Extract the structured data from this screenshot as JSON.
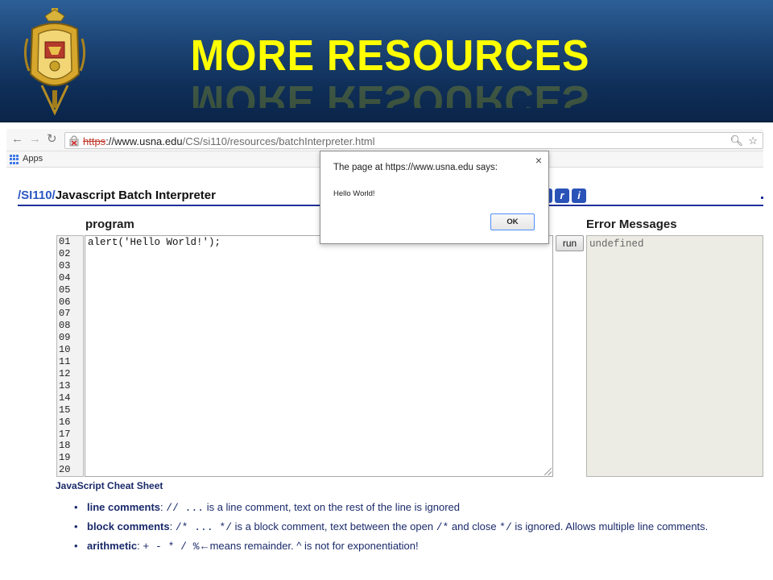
{
  "slide": {
    "title": "MORE RESOURCES"
  },
  "browser": {
    "url": {
      "protocol": "https",
      "separator": "://",
      "host": "www.usna.edu",
      "path": "/CS/si110/resources/batchInterpreter.html"
    },
    "bookmarks": {
      "apps_label": "Apps"
    }
  },
  "page": {
    "breadcrumb_link": "/SI110/",
    "title": "Javascript Batch Interpreter",
    "icon_buttons": [
      "r",
      "i"
    ],
    "program_label": "program",
    "line_numbers": [
      "01",
      "02",
      "03",
      "04",
      "05",
      "06",
      "07",
      "08",
      "09",
      "10",
      "11",
      "12",
      "13",
      "14",
      "15",
      "16",
      "17",
      "18",
      "19",
      "20"
    ],
    "code": "alert('Hello World!');",
    "run_label": "run",
    "errors_label": "Error Messages",
    "error_output": "undefined",
    "cheat_sheet": {
      "title": "JavaScript Cheat Sheet",
      "items": [
        {
          "term": "line comments",
          "sep": ": ",
          "code": "// ...",
          "desc": " is a line comment, text on the rest of the line is ignored"
        },
        {
          "term": "block comments",
          "sep": ": ",
          "code": "/* ... */",
          "desc": " is a block comment, text between the open ",
          "code2": "/*",
          "desc2": " and close ",
          "code3": "*/",
          "desc3": " is ignored. Allows multiple line comments."
        },
        {
          "term": "arithmetic",
          "sep": ": ",
          "code": "+ - * / %",
          "desc": "←means remainder. ^ is not for exponentiation!"
        }
      ]
    }
  },
  "dialog": {
    "header": "The page at https://www.usna.edu says:",
    "message": "Hello World!",
    "ok_label": "OK",
    "close_glyph": "×"
  },
  "colors": {
    "slide_title": "#ffff00",
    "header_bg": "#1c4576",
    "link_blue": "#2b56c4",
    "rule_blue": "#1f2f9a"
  }
}
